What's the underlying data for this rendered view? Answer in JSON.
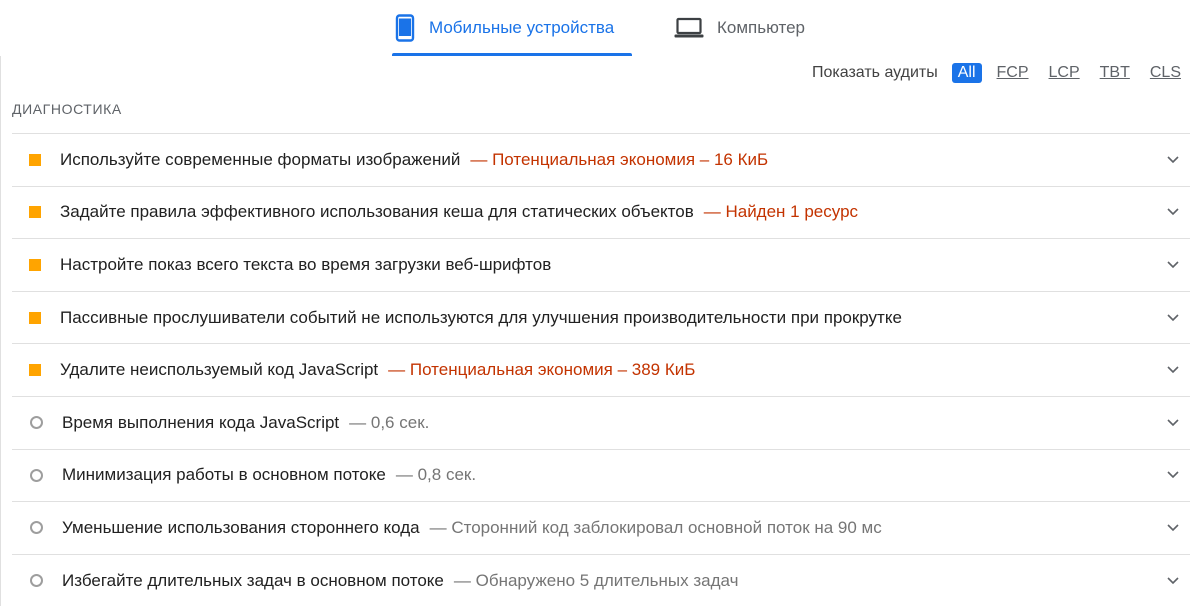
{
  "tabs": [
    {
      "label": "Мобильные устройства",
      "icon": "smartphone-icon",
      "active": true
    },
    {
      "label": "Компьютер",
      "icon": "laptop-icon",
      "active": false
    }
  ],
  "filter": {
    "label": "Показать аудиты",
    "options": [
      "All",
      "FCP",
      "LCP",
      "TBT",
      "CLS"
    ],
    "selected": "All"
  },
  "section": {
    "title": "ДИАГНОСТИКА"
  },
  "audits": [
    {
      "title": "Используйте современные форматы изображений",
      "detail": "— Потенциальная экономия – 16 КиБ",
      "status": "average"
    },
    {
      "title": "Задайте правила эффективного использования кеша для статических объектов",
      "detail": "— Найден 1 ресурс",
      "status": "average"
    },
    {
      "title": "Настройте показ всего текста во время загрузки веб-шрифтов",
      "detail": "",
      "status": "average"
    },
    {
      "title": "Пассивные прослушиватели событий не используются для улучшения производительности при прокрутке",
      "detail": "",
      "status": "average"
    },
    {
      "title": "Удалите неиспользуемый код JavaScript",
      "detail": "— Потенциальная экономия – 389 КиБ",
      "status": "average"
    },
    {
      "title": "Время выполнения кода JavaScript",
      "detail": "— 0,6 сек.",
      "status": "informative"
    },
    {
      "title": "Минимизация работы в основном потоке",
      "detail": "— 0,8 сек.",
      "status": "informative"
    },
    {
      "title": "Уменьшение использования стороннего кода",
      "detail": "— Сторонний код заблокировал основной поток на 90 мс",
      "status": "informative"
    },
    {
      "title": "Избегайте длительных задач в основном потоке",
      "detail": "— Обнаружено 5 длительных задач",
      "status": "informative"
    }
  ],
  "colors": {
    "accent": "#1a73e8",
    "average": "#ffa400",
    "warning_text": "#c33300",
    "muted_text": "#757575"
  }
}
